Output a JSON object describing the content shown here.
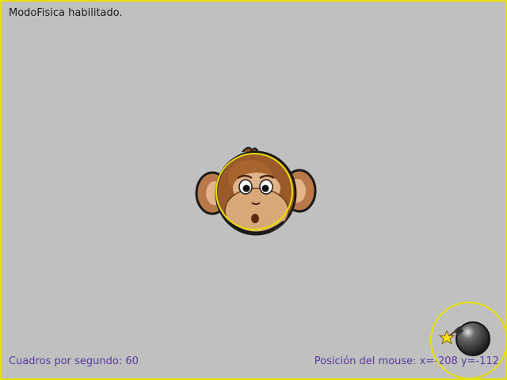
{
  "status_message": "ModoFisica habilitado.",
  "fps_label": "Cuadros por segundo: 60",
  "mouse_position_label": "Posición del mouse: x=-208 y=-112",
  "actors": [
    {
      "name": "monkey",
      "icon": "monkey-icon"
    },
    {
      "name": "bomb",
      "icon": "bomb-icon"
    }
  ],
  "colors": {
    "background": "#c0c0c0",
    "debug_outline": "#e8e000",
    "overlay_text": "#5a3aa0",
    "status_text": "#1a1a1a"
  }
}
